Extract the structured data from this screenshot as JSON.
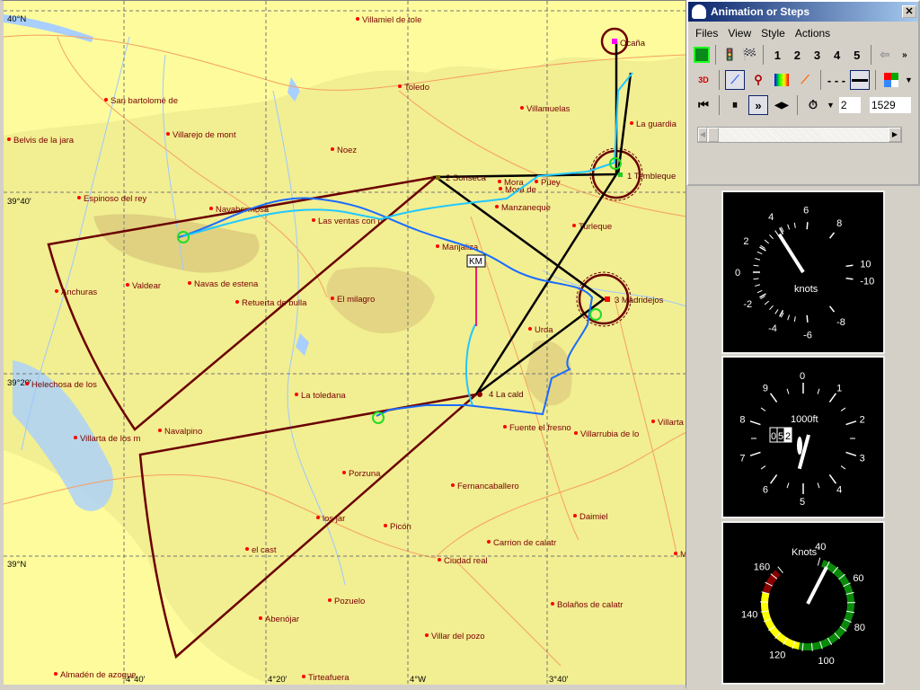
{
  "window": {
    "title": "Animation or Steps",
    "menu": [
      "Files",
      "View",
      "Style",
      "Actions"
    ],
    "task_numbers": [
      "1",
      "2",
      "3",
      "4",
      "5"
    ],
    "timer_value": "2",
    "time_value": "1529"
  },
  "map": {
    "lat_labels": [
      "40°N",
      "39°40'",
      "39°20'",
      "39°N"
    ],
    "lon_labels": [
      "4°40'",
      "4°20'",
      "4°W",
      "3°40'"
    ],
    "turnpoints": [
      "Ocaña",
      "1  Tembleque",
      "2  Sonseca",
      "3  Madridejos",
      "4  La cald"
    ],
    "km_label": "KM",
    "cities": [
      "Villamiel de tole",
      "San bartolomé de",
      "Toledo",
      "Belvis de la jara",
      "Villarejo de mont",
      "Noez",
      "Villamuelas",
      "La guardia",
      "Espinoso del rey",
      "Navahermosa",
      "Las ventas con p",
      "Mora",
      "Mora de",
      "Puey",
      "Manzaneque",
      "Turleque",
      "Manjaliza",
      "Anchuras",
      "Valdear",
      "Navas de estena",
      "Retuerta de bulla",
      "El milagro",
      "Urda",
      "Helechosa de los",
      "La toledana",
      "Navalpino",
      "Villarta de los m",
      "Fuente el fresno",
      "Villarrubia de lo",
      "Villarta d",
      "Porzuna",
      "Fernancaballero",
      "los jar",
      "Picón",
      "Daimiel",
      "Carrion de calatr",
      "el cast",
      "Ciudad real",
      "Ma",
      "Pozuelo",
      "Bolaños de calatr",
      "Abenójar",
      "Villar del pozo",
      "Almadén de azogue",
      "Tirteafuera"
    ]
  },
  "vario": {
    "unit": "knots",
    "labels": [
      "0",
      "2",
      "4",
      "6",
      "8",
      "10",
      "-10",
      "-8",
      "-6",
      "-4",
      "-2"
    ],
    "value": 3.6
  },
  "altimeter": {
    "unit": "1000ft",
    "labels": [
      "0",
      "1",
      "2",
      "3",
      "4",
      "5",
      "6",
      "7",
      "8",
      "9"
    ],
    "drum": [
      "0",
      "5",
      "2"
    ],
    "value_ft": 520
  },
  "airspeed": {
    "unit": "Knots",
    "labels": [
      "40",
      "60",
      "80",
      "100",
      "120",
      "140",
      "160"
    ],
    "value": 45
  },
  "colors": {
    "map_bg": "#f2ee92",
    "task": "#6b0000",
    "track": "#1a6cff",
    "track2": "#20d0ff"
  }
}
